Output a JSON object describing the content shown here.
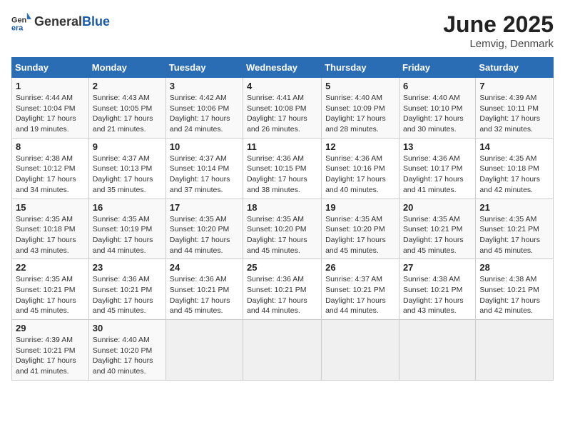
{
  "header": {
    "logo_general": "General",
    "logo_blue": "Blue",
    "month_year": "June 2025",
    "location": "Lemvig, Denmark"
  },
  "weekdays": [
    "Sunday",
    "Monday",
    "Tuesday",
    "Wednesday",
    "Thursday",
    "Friday",
    "Saturday"
  ],
  "weeks": [
    [
      {
        "day": "1",
        "sunrise": "Sunrise: 4:44 AM",
        "sunset": "Sunset: 10:04 PM",
        "daylight": "Daylight: 17 hours and 19 minutes."
      },
      {
        "day": "2",
        "sunrise": "Sunrise: 4:43 AM",
        "sunset": "Sunset: 10:05 PM",
        "daylight": "Daylight: 17 hours and 21 minutes."
      },
      {
        "day": "3",
        "sunrise": "Sunrise: 4:42 AM",
        "sunset": "Sunset: 10:06 PM",
        "daylight": "Daylight: 17 hours and 24 minutes."
      },
      {
        "day": "4",
        "sunrise": "Sunrise: 4:41 AM",
        "sunset": "Sunset: 10:08 PM",
        "daylight": "Daylight: 17 hours and 26 minutes."
      },
      {
        "day": "5",
        "sunrise": "Sunrise: 4:40 AM",
        "sunset": "Sunset: 10:09 PM",
        "daylight": "Daylight: 17 hours and 28 minutes."
      },
      {
        "day": "6",
        "sunrise": "Sunrise: 4:40 AM",
        "sunset": "Sunset: 10:10 PM",
        "daylight": "Daylight: 17 hours and 30 minutes."
      },
      {
        "day": "7",
        "sunrise": "Sunrise: 4:39 AM",
        "sunset": "Sunset: 10:11 PM",
        "daylight": "Daylight: 17 hours and 32 minutes."
      }
    ],
    [
      {
        "day": "8",
        "sunrise": "Sunrise: 4:38 AM",
        "sunset": "Sunset: 10:12 PM",
        "daylight": "Daylight: 17 hours and 34 minutes."
      },
      {
        "day": "9",
        "sunrise": "Sunrise: 4:37 AM",
        "sunset": "Sunset: 10:13 PM",
        "daylight": "Daylight: 17 hours and 35 minutes."
      },
      {
        "day": "10",
        "sunrise": "Sunrise: 4:37 AM",
        "sunset": "Sunset: 10:14 PM",
        "daylight": "Daylight: 17 hours and 37 minutes."
      },
      {
        "day": "11",
        "sunrise": "Sunrise: 4:36 AM",
        "sunset": "Sunset: 10:15 PM",
        "daylight": "Daylight: 17 hours and 38 minutes."
      },
      {
        "day": "12",
        "sunrise": "Sunrise: 4:36 AM",
        "sunset": "Sunset: 10:16 PM",
        "daylight": "Daylight: 17 hours and 40 minutes."
      },
      {
        "day": "13",
        "sunrise": "Sunrise: 4:36 AM",
        "sunset": "Sunset: 10:17 PM",
        "daylight": "Daylight: 17 hours and 41 minutes."
      },
      {
        "day": "14",
        "sunrise": "Sunrise: 4:35 AM",
        "sunset": "Sunset: 10:18 PM",
        "daylight": "Daylight: 17 hours and 42 minutes."
      }
    ],
    [
      {
        "day": "15",
        "sunrise": "Sunrise: 4:35 AM",
        "sunset": "Sunset: 10:18 PM",
        "daylight": "Daylight: 17 hours and 43 minutes."
      },
      {
        "day": "16",
        "sunrise": "Sunrise: 4:35 AM",
        "sunset": "Sunset: 10:19 PM",
        "daylight": "Daylight: 17 hours and 44 minutes."
      },
      {
        "day": "17",
        "sunrise": "Sunrise: 4:35 AM",
        "sunset": "Sunset: 10:20 PM",
        "daylight": "Daylight: 17 hours and 44 minutes."
      },
      {
        "day": "18",
        "sunrise": "Sunrise: 4:35 AM",
        "sunset": "Sunset: 10:20 PM",
        "daylight": "Daylight: 17 hours and 45 minutes."
      },
      {
        "day": "19",
        "sunrise": "Sunrise: 4:35 AM",
        "sunset": "Sunset: 10:20 PM",
        "daylight": "Daylight: 17 hours and 45 minutes."
      },
      {
        "day": "20",
        "sunrise": "Sunrise: 4:35 AM",
        "sunset": "Sunset: 10:21 PM",
        "daylight": "Daylight: 17 hours and 45 minutes."
      },
      {
        "day": "21",
        "sunrise": "Sunrise: 4:35 AM",
        "sunset": "Sunset: 10:21 PM",
        "daylight": "Daylight: 17 hours and 45 minutes."
      }
    ],
    [
      {
        "day": "22",
        "sunrise": "Sunrise: 4:35 AM",
        "sunset": "Sunset: 10:21 PM",
        "daylight": "Daylight: 17 hours and 45 minutes."
      },
      {
        "day": "23",
        "sunrise": "Sunrise: 4:36 AM",
        "sunset": "Sunset: 10:21 PM",
        "daylight": "Daylight: 17 hours and 45 minutes."
      },
      {
        "day": "24",
        "sunrise": "Sunrise: 4:36 AM",
        "sunset": "Sunset: 10:21 PM",
        "daylight": "Daylight: 17 hours and 45 minutes."
      },
      {
        "day": "25",
        "sunrise": "Sunrise: 4:36 AM",
        "sunset": "Sunset: 10:21 PM",
        "daylight": "Daylight: 17 hours and 44 minutes."
      },
      {
        "day": "26",
        "sunrise": "Sunrise: 4:37 AM",
        "sunset": "Sunset: 10:21 PM",
        "daylight": "Daylight: 17 hours and 44 minutes."
      },
      {
        "day": "27",
        "sunrise": "Sunrise: 4:38 AM",
        "sunset": "Sunset: 10:21 PM",
        "daylight": "Daylight: 17 hours and 43 minutes."
      },
      {
        "day": "28",
        "sunrise": "Sunrise: 4:38 AM",
        "sunset": "Sunset: 10:21 PM",
        "daylight": "Daylight: 17 hours and 42 minutes."
      }
    ],
    [
      {
        "day": "29",
        "sunrise": "Sunrise: 4:39 AM",
        "sunset": "Sunset: 10:21 PM",
        "daylight": "Daylight: 17 hours and 41 minutes."
      },
      {
        "day": "30",
        "sunrise": "Sunrise: 4:40 AM",
        "sunset": "Sunset: 10:20 PM",
        "daylight": "Daylight: 17 hours and 40 minutes."
      },
      null,
      null,
      null,
      null,
      null
    ]
  ]
}
